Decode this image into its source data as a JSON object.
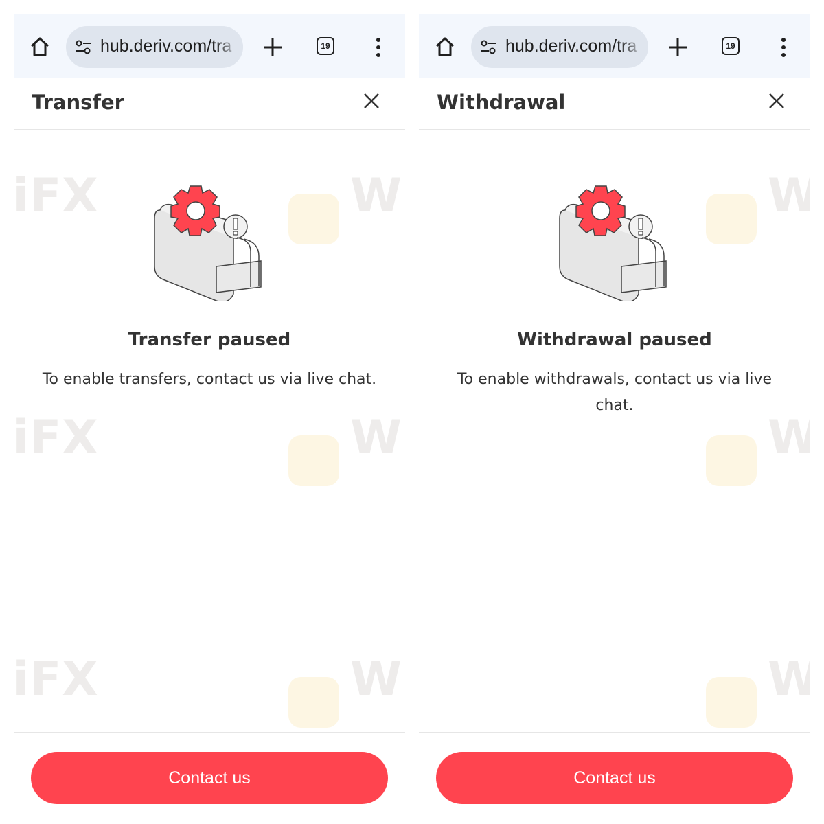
{
  "panels": [
    {
      "browser": {
        "url": "hub.deriv.com/tra",
        "tab_count": "19",
        "icons": [
          "home-icon",
          "site-settings-icon",
          "new-tab-icon",
          "tab-switcher-icon",
          "more-options-icon"
        ]
      },
      "modal": {
        "title": "Transfer",
        "close_icon": "close-icon",
        "illustration": "wallet-gear-paused",
        "status_title": "Transfer paused",
        "status_message": "To enable transfers, contact us via live chat.",
        "button_label": "Contact us"
      }
    },
    {
      "browser": {
        "url": "hub.deriv.com/tra",
        "tab_count": "19",
        "icons": [
          "home-icon",
          "site-settings-icon",
          "new-tab-icon",
          "tab-switcher-icon",
          "more-options-icon"
        ]
      },
      "modal": {
        "title": "Withdrawal",
        "close_icon": "close-icon",
        "illustration": "wallet-gear-paused",
        "status_title": "Withdrawal paused",
        "status_message": "To enable withdrawals, contact us via live chat.",
        "button_label": "Contact us"
      }
    }
  ],
  "watermark": {
    "text": "WikiFX"
  },
  "colors": {
    "accent": "#ff444f",
    "browser_bar": "#f3f7fd",
    "url_pill": "#dfe5ee",
    "text": "#333333",
    "gear": "#ff444f"
  }
}
